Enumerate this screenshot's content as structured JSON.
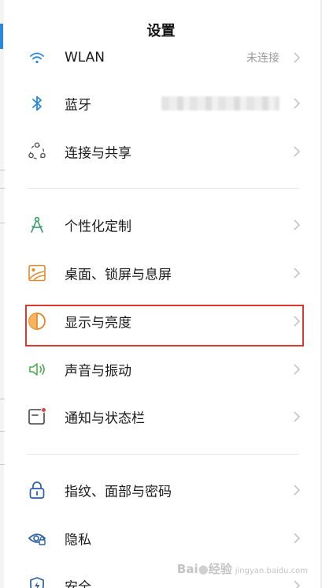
{
  "header": {
    "title": "设置"
  },
  "rows": [
    {
      "id": "wlan",
      "label": "WLAN",
      "value": "未连接",
      "icon": "wifi-icon"
    },
    {
      "id": "bluetooth",
      "label": "蓝牙",
      "value": "",
      "icon": "bluetooth-icon"
    },
    {
      "id": "connect-share",
      "label": "连接与共享",
      "value": "",
      "icon": "share-nodes-icon"
    },
    {
      "id": "personalize",
      "label": "个性化定制",
      "value": "",
      "icon": "compass-icon"
    },
    {
      "id": "desktop-lock",
      "label": "桌面、锁屏与息屏",
      "value": "",
      "icon": "wallpaper-icon"
    },
    {
      "id": "display-brightness",
      "label": "显示与亮度",
      "value": "",
      "icon": "brightness-icon"
    },
    {
      "id": "sound-vibration",
      "label": "声音与振动",
      "value": "",
      "icon": "speaker-icon"
    },
    {
      "id": "notification-statusbar",
      "label": "通知与状态栏",
      "value": "",
      "icon": "notification-icon"
    },
    {
      "id": "fingerprint-face-password",
      "label": "指纹、面部与密码",
      "value": "",
      "icon": "lock-icon"
    },
    {
      "id": "privacy",
      "label": "隐私",
      "value": "",
      "icon": "privacy-eye-icon"
    },
    {
      "id": "security",
      "label": "安全",
      "value": "",
      "icon": "shield-icon"
    }
  ],
  "watermark": {
    "brand": "Bai",
    "brand_tail": "经验",
    "sub": "jingyan.baidu.com"
  },
  "colors": {
    "accent_blue": "#2b87da",
    "highlight_red": "#d83a2f",
    "personalize_green": "#3a9a6a",
    "desktop_orange": "#e08a2a",
    "display_orange": "#e9821f",
    "sound_green": "#4caf50",
    "notification_red": "#e0454a"
  }
}
